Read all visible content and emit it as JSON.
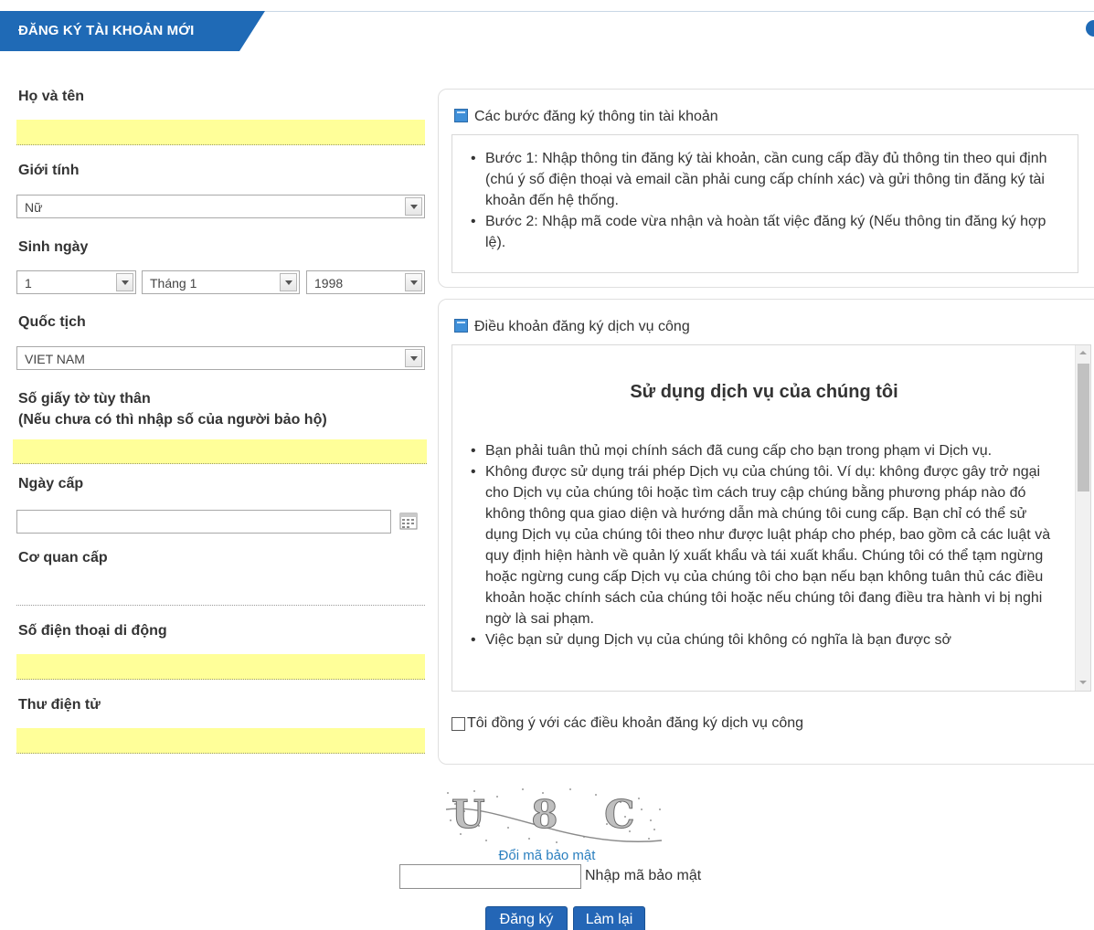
{
  "header": {
    "title": "ĐĂNG KÝ TÀI KHOẢN MỚI"
  },
  "form": {
    "full_name_label": "Họ và tên",
    "full_name_value": "",
    "gender_label": "Giới tính",
    "gender_value": "Nữ",
    "birth_label": "Sinh ngày",
    "birth_day": "1",
    "birth_month": "Tháng 1",
    "birth_year": "1998",
    "nationality_label": "Quốc tịch",
    "nationality_value": "VIET NAM",
    "id_label": "Số giấy tờ tùy thân",
    "id_sublabel": "(Nếu chưa có thì nhập số của người bảo hộ)",
    "issue_date_label": "Ngày cấp",
    "issue_date_value": "",
    "issuer_label": "Cơ quan cấp",
    "phone_label": "Số điện thoại di động",
    "email_label": "Thư điện tử"
  },
  "steps": {
    "title": "Các bước đăng ký thông tin tài khoản",
    "items": [
      "Bước 1: Nhập thông tin đăng ký tài khoản, cần cung cấp đầy đủ thông tin theo qui định (chú ý số điện thoại và email cần phải cung cấp chính xác) và gửi thông tin đăng ký tài khoản đến hệ thống.",
      "Bước 2: Nhập mã code vừa nhận và hoàn tất việc đăng ký (Nếu thông tin đăng ký hợp lệ)."
    ]
  },
  "terms": {
    "title": "Điều khoản đăng ký dịch vụ công",
    "heading": "Sử dụng dịch vụ của chúng tôi",
    "items": [
      "Bạn phải tuân thủ mọi chính sách đã cung cấp cho bạn trong phạm vi Dịch vụ.",
      "Không được sử dụng trái phép Dịch vụ của chúng tôi. Ví dụ: không được gây trở ngại cho Dịch vụ của chúng tôi hoặc tìm cách truy cập chúng bằng phương pháp nào đó không thông qua giao diện và hướng dẫn mà chúng tôi cung cấp. Bạn chỉ có thể sử dụng Dịch vụ của chúng tôi theo như được luật pháp cho phép, bao gồm cả các luật và quy định hiện hành về quản lý xuất khẩu và tái xuất khẩu. Chúng tôi có thể tạm ngừng hoặc ngừng cung cấp Dịch vụ của chúng tôi cho bạn nếu bạn không tuân thủ các điều khoản hoặc chính sách của chúng tôi hoặc nếu chúng tôi đang điều tra hành vi bị nghi ngờ là sai phạm.",
      "Việc bạn sử dụng Dịch vụ của chúng tôi không có nghĩa là bạn được sở"
    ],
    "agree_label": "Tôi đồng ý với các điều khoản đăng ký dịch vụ công"
  },
  "captcha": {
    "text": "U 8 C",
    "change_link": "Đổi mã bảo mật",
    "input_label": "Nhập mã bảo mật"
  },
  "buttons": {
    "register": "Đăng ký",
    "reset": "Làm lại"
  },
  "colors": {
    "brand": "#1f6ab6",
    "field_highlight": "#ffff99",
    "link": "#2a7fbf"
  }
}
